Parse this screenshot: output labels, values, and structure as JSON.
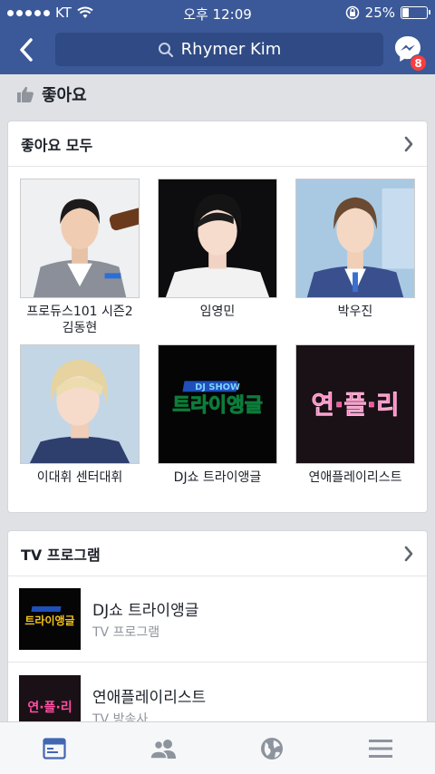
{
  "status_bar": {
    "carrier": "KT",
    "time": "오후 12:09",
    "battery": "25%",
    "battery_level": 0.25
  },
  "nav": {
    "search_text": "Rhymer Kim",
    "messenger_badge": "8"
  },
  "likes_header": {
    "label": "좋아요"
  },
  "all_likes": {
    "title": "좋아요 모두",
    "items": [
      {
        "line1": "프로듀스101 시즌2",
        "line2": "김동현"
      },
      {
        "line1": "임영민",
        "line2": ""
      },
      {
        "line1": "박우진",
        "line2": ""
      },
      {
        "line1": "이대휘 센터대휘",
        "line2": ""
      },
      {
        "line1": "DJ쇼 트라이앵글",
        "line2": ""
      },
      {
        "line1": "연애플레이리스트",
        "line2": ""
      }
    ],
    "logo_text_1": "트라이앵글",
    "logo_text_1_top": "DJ SHOW",
    "logo_text_2": "연·플·리"
  },
  "tv_programs": {
    "title": "TV 프로그램",
    "rows": [
      {
        "name": "DJ쇼 트라이앵글",
        "category": "TV 프로그램"
      },
      {
        "name": "연애플레이리스트",
        "category": "TV 방송사"
      }
    ]
  },
  "colors": {
    "nav_blue": "#3b5998",
    "active_tab": "#4267b2",
    "inactive_tab": "#8d949e",
    "badge_red": "#fa3e3e"
  }
}
